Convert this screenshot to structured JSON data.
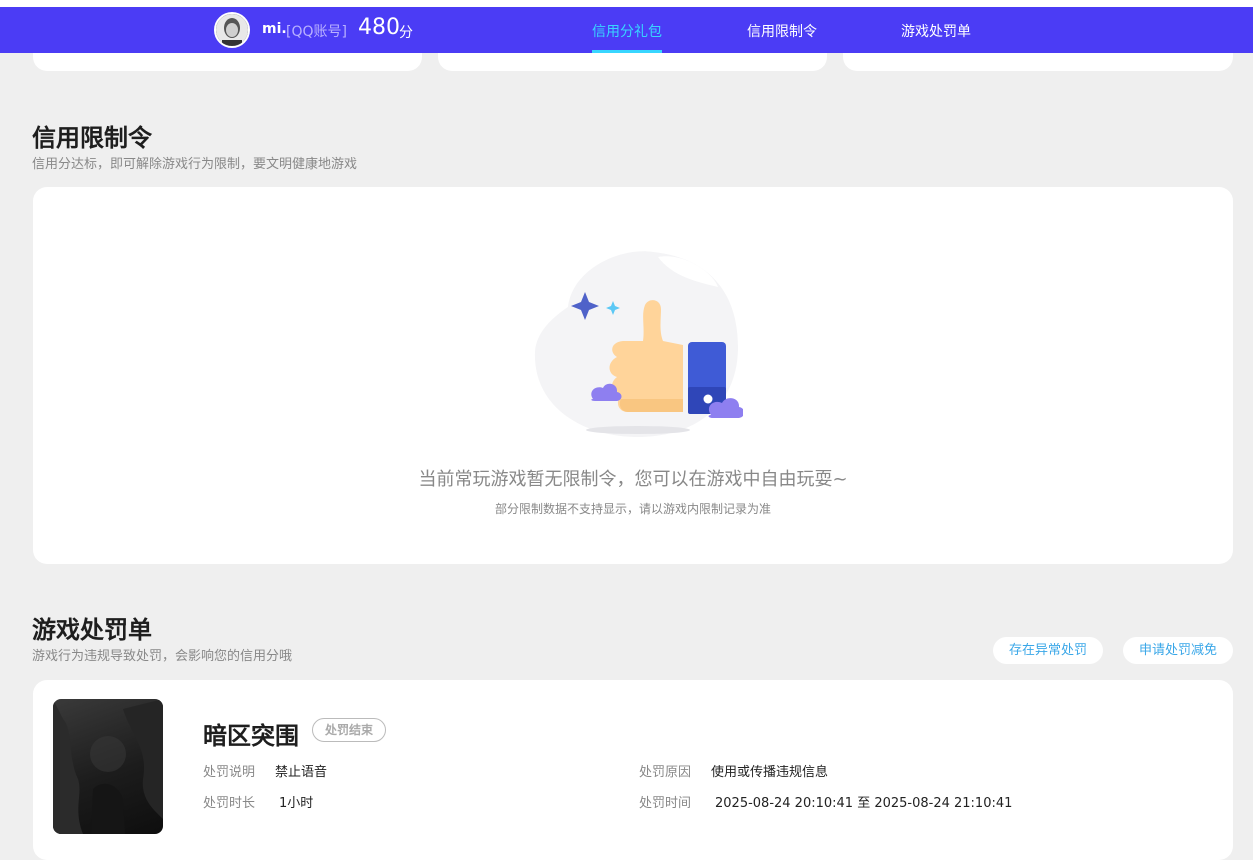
{
  "header": {
    "user_name": "mi.",
    "user_account": "[QQ账号]",
    "score": "480",
    "score_unit": "分",
    "tabs": [
      {
        "label": "信用分礼包",
        "active": true
      },
      {
        "label": "信用限制令",
        "active": false
      },
      {
        "label": "游戏处罚单",
        "active": false
      }
    ]
  },
  "restriction": {
    "title": "信用限制令",
    "subtitle": "信用分达标，即可解除游戏行为限制，要文明健康地游戏",
    "empty_main": "当前常玩游戏暂无限制令，您可以在游戏中自由玩耍~",
    "empty_sub": "部分限制数据不支持显示，请以游戏内限制记录为准"
  },
  "penalty": {
    "title": "游戏处罚单",
    "subtitle": "游戏行为违规导致处罚，会影响您的信用分哦",
    "btn_abnormal": "存在异常处罚",
    "btn_reduce": "申请处罚减免",
    "item": {
      "game": "暗区突围",
      "status": "处罚结束",
      "desc_label": "处罚说明",
      "desc_value": "禁止语音",
      "duration_label": "处罚时长",
      "duration_value": "1小时",
      "reason_label": "处罚原因",
      "reason_value": "使用或传播违规信息",
      "time_label": "处罚时间",
      "time_value": "2025-08-24 20:10:41 至 2025-08-24 21:10:41"
    }
  },
  "colors": {
    "header_bg": "#4b3cf5",
    "active_tab": "#38d6ff",
    "link": "#3aa7e8"
  }
}
